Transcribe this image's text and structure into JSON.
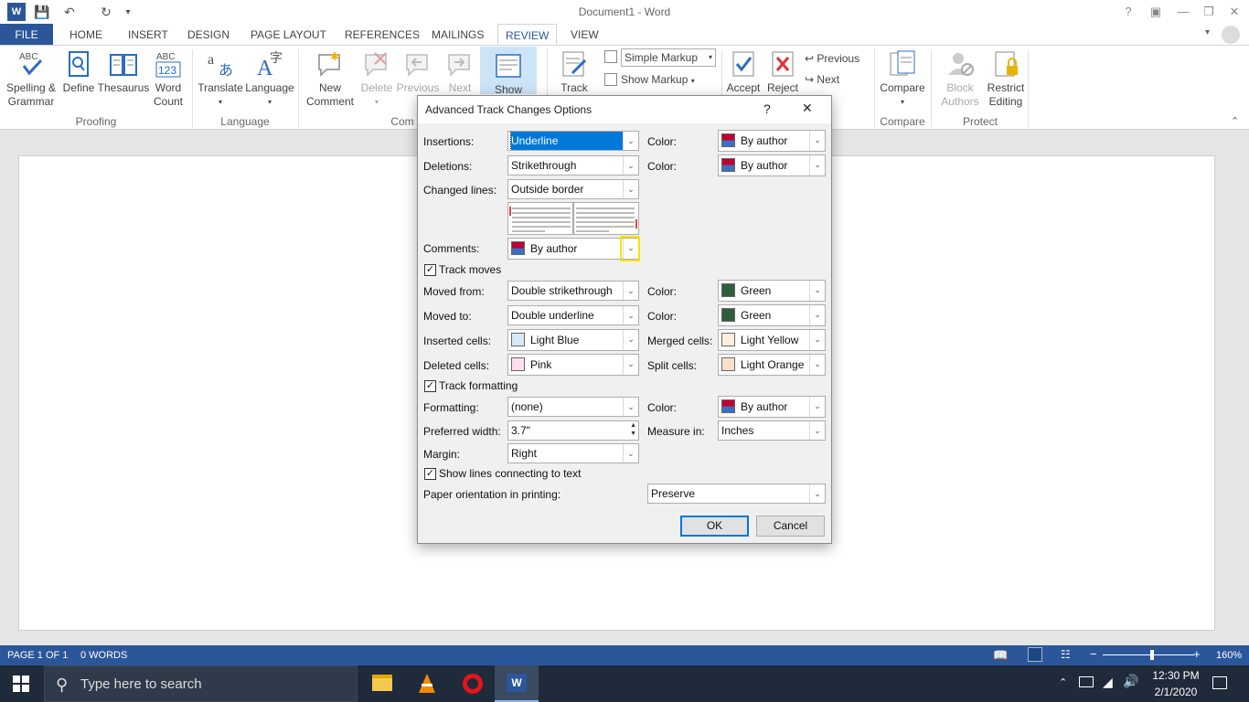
{
  "window": {
    "title": "Document1 - Word",
    "help_label": "?",
    "account_label": "?"
  },
  "tabs": [
    "FILE",
    "HOME",
    "INSERT",
    "DESIGN",
    "PAGE LAYOUT",
    "REFERENCES",
    "MAILINGS",
    "REVIEW",
    "VIEW"
  ],
  "ribbon": {
    "proofing": {
      "spelling": "Spelling &",
      "spelling2": "Grammar",
      "define": "Define",
      "thesaurus": "Thesaurus",
      "word_count": "Word",
      "word_count2": "Count",
      "group": "Proofing"
    },
    "language": {
      "translate": "Translate",
      "language": "Language",
      "group": "Language"
    },
    "comments": {
      "new": "New",
      "new2": "Comment",
      "delete": "Delete",
      "previous": "Previous",
      "next": "Next",
      "show": "Show",
      "group": "Com"
    },
    "tracking": {
      "track": "Track",
      "markup_select": "Simple Markup",
      "show_markup": "Show Markup"
    },
    "changes": {
      "accept": "Accept",
      "reject": "Reject",
      "previous": "Previous",
      "next": "Next"
    },
    "compare": {
      "compare": "Compare",
      "group": "Compare"
    },
    "protect": {
      "block": "Block",
      "block2": "Authors",
      "restrict": "Restrict",
      "restrict2": "Editing",
      "group": "Protect"
    }
  },
  "dialog": {
    "title": "Advanced Track Changes Options",
    "help": "?",
    "close": "✕",
    "insertions": {
      "label": "Insertions:",
      "value": "Underline",
      "color_label": "Color:",
      "color": "By author"
    },
    "deletions": {
      "label": "Deletions:",
      "value": "Strikethrough",
      "color_label": "Color:",
      "color": "By author"
    },
    "changed_lines": {
      "label": "Changed lines:",
      "value": "Outside border"
    },
    "comments": {
      "label": "Comments:",
      "value": "By author"
    },
    "track_moves": {
      "label": "Track moves",
      "checked": true
    },
    "moved_from": {
      "label": "Moved from:",
      "value": "Double strikethrough",
      "color_label": "Color:",
      "color": "Green",
      "swatch": "#2e5e3a"
    },
    "moved_to": {
      "label": "Moved to:",
      "value": "Double underline",
      "color_label": "Color:",
      "color": "Green",
      "swatch": "#2e5e3a"
    },
    "inserted_cells": {
      "label": "Inserted cells:",
      "value": "Light Blue",
      "swatch": "#d7e9f7",
      "merged_label": "Merged cells:",
      "merged": "Light Yellow",
      "merged_swatch": "#fbeedb"
    },
    "deleted_cells": {
      "label": "Deleted cells:",
      "value": "Pink",
      "swatch": "#fde0ef",
      "split_label": "Split cells:",
      "split": "Light Orange",
      "split_swatch": "#fae0cc"
    },
    "track_formatting": {
      "label": "Track formatting",
      "checked": true
    },
    "formatting": {
      "label": "Formatting:",
      "value": "(none)",
      "color_label": "Color:",
      "color": "By author"
    },
    "preferred_width": {
      "label": "Preferred width:",
      "value": "3.7\"",
      "measure_label": "Measure in:",
      "measure": "Inches"
    },
    "margin": {
      "label": "Margin:",
      "value": "Right"
    },
    "show_lines": {
      "label": "Show lines connecting to text",
      "checked": true
    },
    "paper_orientation": {
      "label": "Paper orientation in printing:",
      "value": "Preserve"
    },
    "ok": "OK",
    "cancel": "Cancel"
  },
  "status": {
    "page": "PAGE 1 OF 1",
    "words": "0 WORDS",
    "zoom": "160%"
  },
  "taskbar": {
    "search_placeholder": "Type here to search",
    "time": "12:30 PM",
    "date": "2/1/2020"
  },
  "colors": {
    "accent": "#2b579a",
    "highlight": "#f5e400"
  }
}
